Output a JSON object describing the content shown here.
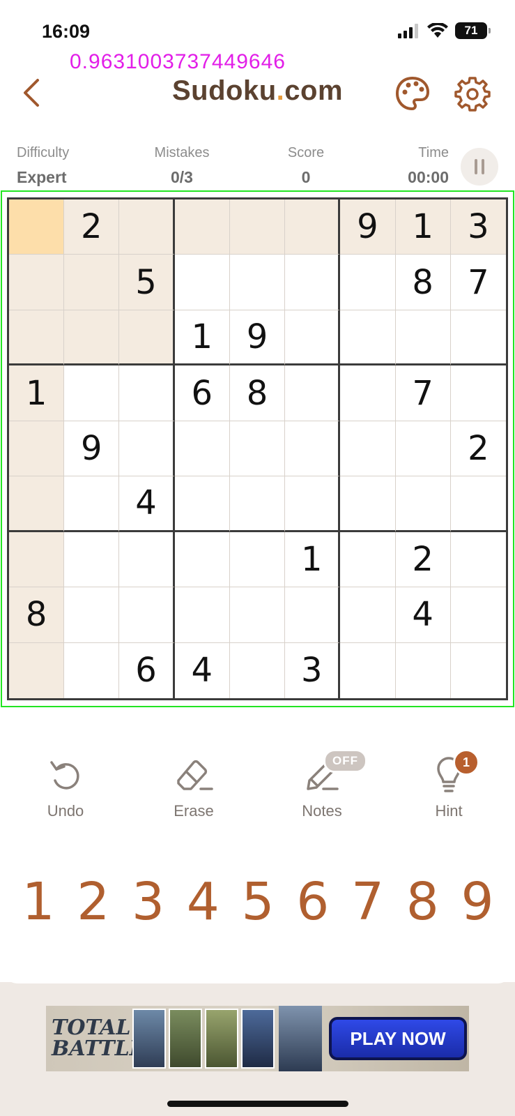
{
  "status_bar": {
    "time": "16:09",
    "battery": "71",
    "icons": [
      "signal-icon",
      "wifi-icon",
      "battery-icon"
    ]
  },
  "debug_value": "0.9631003737449646",
  "header": {
    "title_main": "Sudoku",
    "title_dot": ".",
    "title_suffix": "com",
    "icons": [
      "back-arrow-icon",
      "palette-icon",
      "gear-icon"
    ]
  },
  "stats": {
    "difficulty_label": "Difficulty",
    "difficulty_value": "Expert",
    "mistakes_label": "Mistakes",
    "mistakes_value": "0/3",
    "score_label": "Score",
    "score_value": "0",
    "time_label": "Time",
    "time_value": "00:00"
  },
  "board": {
    "selected_cell": [
      0,
      0
    ],
    "grid": [
      [
        "",
        "2",
        "",
        "",
        "",
        "",
        "9",
        "1",
        "3"
      ],
      [
        "",
        "",
        "5",
        "",
        "",
        "",
        "",
        "8",
        "7"
      ],
      [
        "",
        "",
        "",
        "1",
        "9",
        "",
        "",
        "",
        ""
      ],
      [
        "1",
        "",
        "",
        "6",
        "8",
        "",
        "",
        "7",
        ""
      ],
      [
        "",
        "9",
        "",
        "",
        "",
        "",
        "",
        "",
        "2"
      ],
      [
        "",
        "",
        "4",
        "",
        "",
        "",
        "",
        "",
        ""
      ],
      [
        "",
        "",
        "",
        "",
        "",
        "1",
        "",
        "2",
        ""
      ],
      [
        "8",
        "",
        "",
        "",
        "",
        "",
        "",
        "4",
        ""
      ],
      [
        "",
        "",
        "6",
        "4",
        "",
        "3",
        "",
        "",
        ""
      ]
    ],
    "colors": {
      "highlight": "#f4ebe0",
      "selected": "#fddeaa",
      "outline": "#22e522"
    }
  },
  "tools": {
    "undo_label": "Undo",
    "erase_label": "Erase",
    "notes_label": "Notes",
    "notes_state": "OFF",
    "hint_label": "Hint",
    "hint_count": "1"
  },
  "numpad": [
    "1",
    "2",
    "3",
    "4",
    "5",
    "6",
    "7",
    "8",
    "9"
  ],
  "ad": {
    "logo_line1": "TOTAL",
    "logo_line2": "BATTLE",
    "cta": "PLAY NOW"
  }
}
